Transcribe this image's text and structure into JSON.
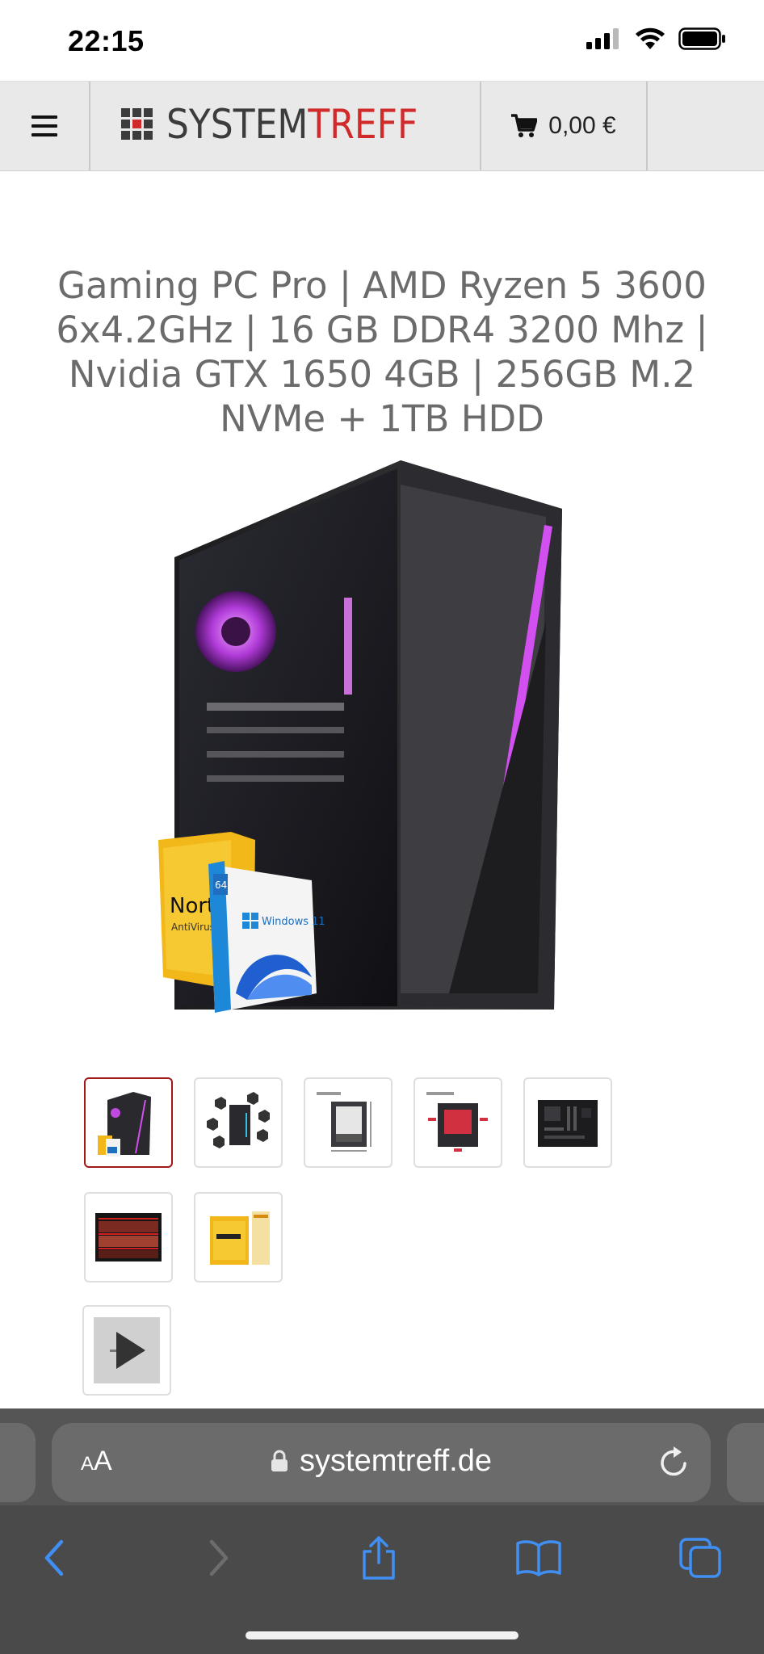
{
  "status_bar": {
    "time": "22:15"
  },
  "header": {
    "logo_part1": "SYSTEM",
    "logo_part2": "TREFF",
    "cart_total": "0,00 €"
  },
  "product": {
    "title": "Gaming PC Pro | AMD Ryzen 5 3600 6x4.2GHz | 16 GB DDR4 3200 Mhz | Nvidia GTX 1650 4GB | 256GB M.2 NVMe + 1TB HDD",
    "image_labels": {
      "norton": "Norton",
      "antivirus": "AntiVirus",
      "windows": "Windows 11",
      "bits": "64"
    }
  },
  "thumbnails": [
    {
      "name": "pc-front",
      "active": true
    },
    {
      "name": "pc-components",
      "active": false
    },
    {
      "name": "case-dimensions",
      "active": false
    },
    {
      "name": "cooling",
      "active": false
    },
    {
      "name": "motherboard",
      "active": false
    },
    {
      "name": "game-screens",
      "active": false
    },
    {
      "name": "norton-box",
      "active": false
    },
    {
      "name": "video",
      "active": false
    }
  ],
  "browser": {
    "text_size_label": "AA",
    "url": "systemtreff.de"
  },
  "colors": {
    "brand_red": "#d12a2a",
    "active_thumb_border": "#a01818",
    "ios_blue": "#3f8ff5"
  }
}
